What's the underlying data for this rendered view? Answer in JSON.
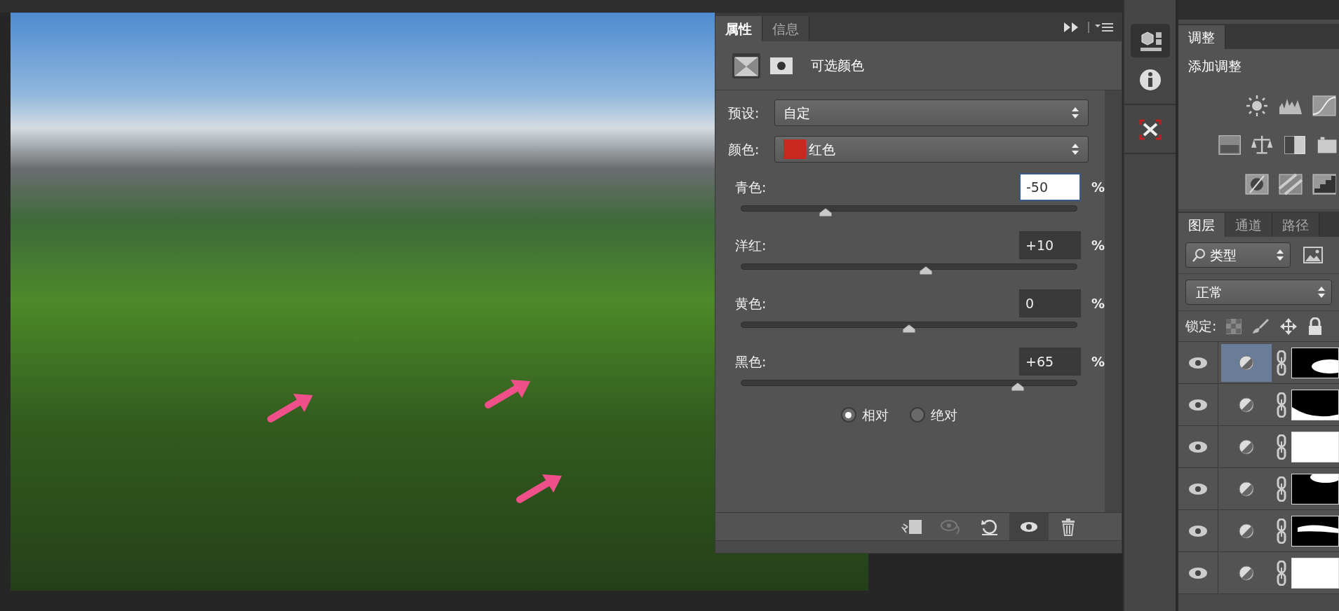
{
  "properties_panel": {
    "tabs": [
      {
        "label": "属性",
        "selected": true
      },
      {
        "label": "信息",
        "selected": false
      }
    ],
    "modes": [
      {
        "kind": "adjustment",
        "selected": true
      },
      {
        "kind": "mask",
        "selected": false
      }
    ],
    "title": "可选颜色",
    "preset": {
      "label": "预设:",
      "value": "自定"
    },
    "color": {
      "label": "颜色:",
      "value": "红色"
    },
    "sliders": [
      {
        "label": "青色:",
        "value": "-50",
        "unit": "%",
        "level": 0.25,
        "focused": true
      },
      {
        "label": "洋红:",
        "value": "+10",
        "unit": "%",
        "level": 0.55,
        "focused": false
      },
      {
        "label": "黄色:",
        "value": "0",
        "unit": "%",
        "level": 0.5,
        "focused": false
      },
      {
        "label": "黑色:",
        "value": "+65",
        "unit": "%",
        "level": 0.825,
        "focused": false
      }
    ],
    "method": [
      {
        "label": "相对",
        "selected": true
      },
      {
        "label": "绝对",
        "selected": false
      }
    ],
    "toolbar": [
      {
        "kind": "clip",
        "on": false
      },
      {
        "kind": "previous",
        "on": false
      },
      {
        "kind": "reset",
        "on": false
      },
      {
        "kind": "visibility",
        "on": true
      },
      {
        "kind": "delete",
        "on": false
      }
    ]
  },
  "dock_strip": {
    "buttons": [
      {
        "kind": "properties",
        "selected": true
      },
      {
        "kind": "info",
        "selected": false
      },
      {
        "kind": "collapse",
        "selected": false
      }
    ]
  },
  "adjustments_panel": {
    "tab": "调整",
    "title": "添加调整"
  },
  "layers_panel": {
    "tabs": [
      {
        "label": "图层",
        "selected": true
      },
      {
        "label": "通道",
        "selected": false
      },
      {
        "label": "路径",
        "selected": false
      }
    ],
    "filter": "类型",
    "blend_mode": "正常",
    "lock_label": "锁定:",
    "layers": [
      {
        "selected": true,
        "visible": true
      },
      {
        "selected": false,
        "visible": true
      },
      {
        "selected": false,
        "visible": true
      },
      {
        "selected": false,
        "visible": true
      },
      {
        "selected": false,
        "visible": true
      },
      {
        "selected": false,
        "visible": true
      }
    ]
  }
}
